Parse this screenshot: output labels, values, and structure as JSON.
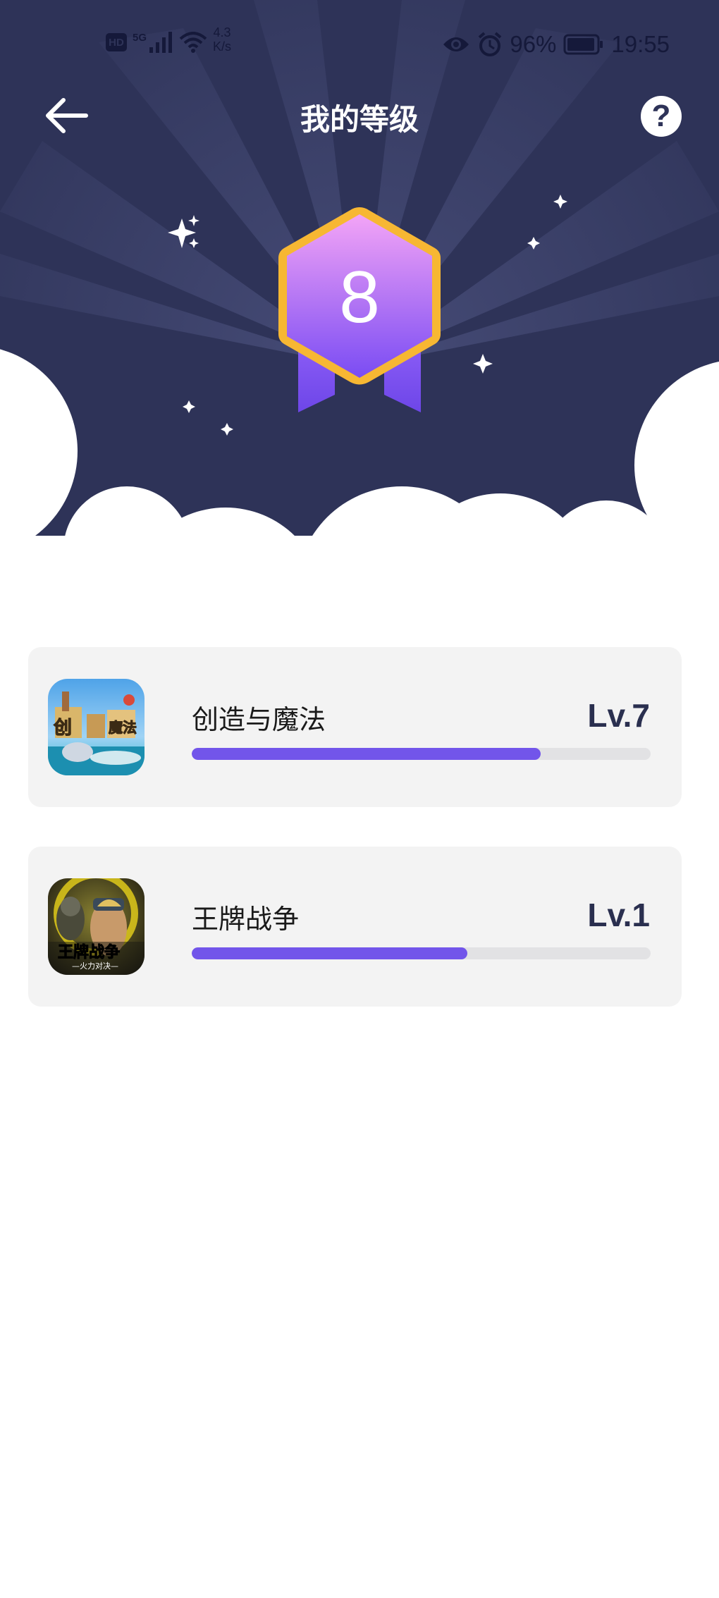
{
  "status_bar": {
    "hd": "HD",
    "network": "5G",
    "speed_value": "4.3",
    "speed_unit": "K/s",
    "battery": "96%",
    "time": "19:55"
  },
  "nav": {
    "title": "我的等级",
    "help_label": "?"
  },
  "badge": {
    "level": "8"
  },
  "games": [
    {
      "name": "创造与魔法",
      "level": "Lv.7",
      "progress": 0.76,
      "icon": "creation-magic-game-icon"
    },
    {
      "name": "王牌战争",
      "level": "Lv.1",
      "progress": 0.6,
      "icon": "ace-war-game-icon"
    }
  ],
  "colors": {
    "header_bg": "#2e3358",
    "accent": "#7255ea",
    "badge_gold": "#f7b733",
    "card_bg": "#f3f3f3"
  }
}
